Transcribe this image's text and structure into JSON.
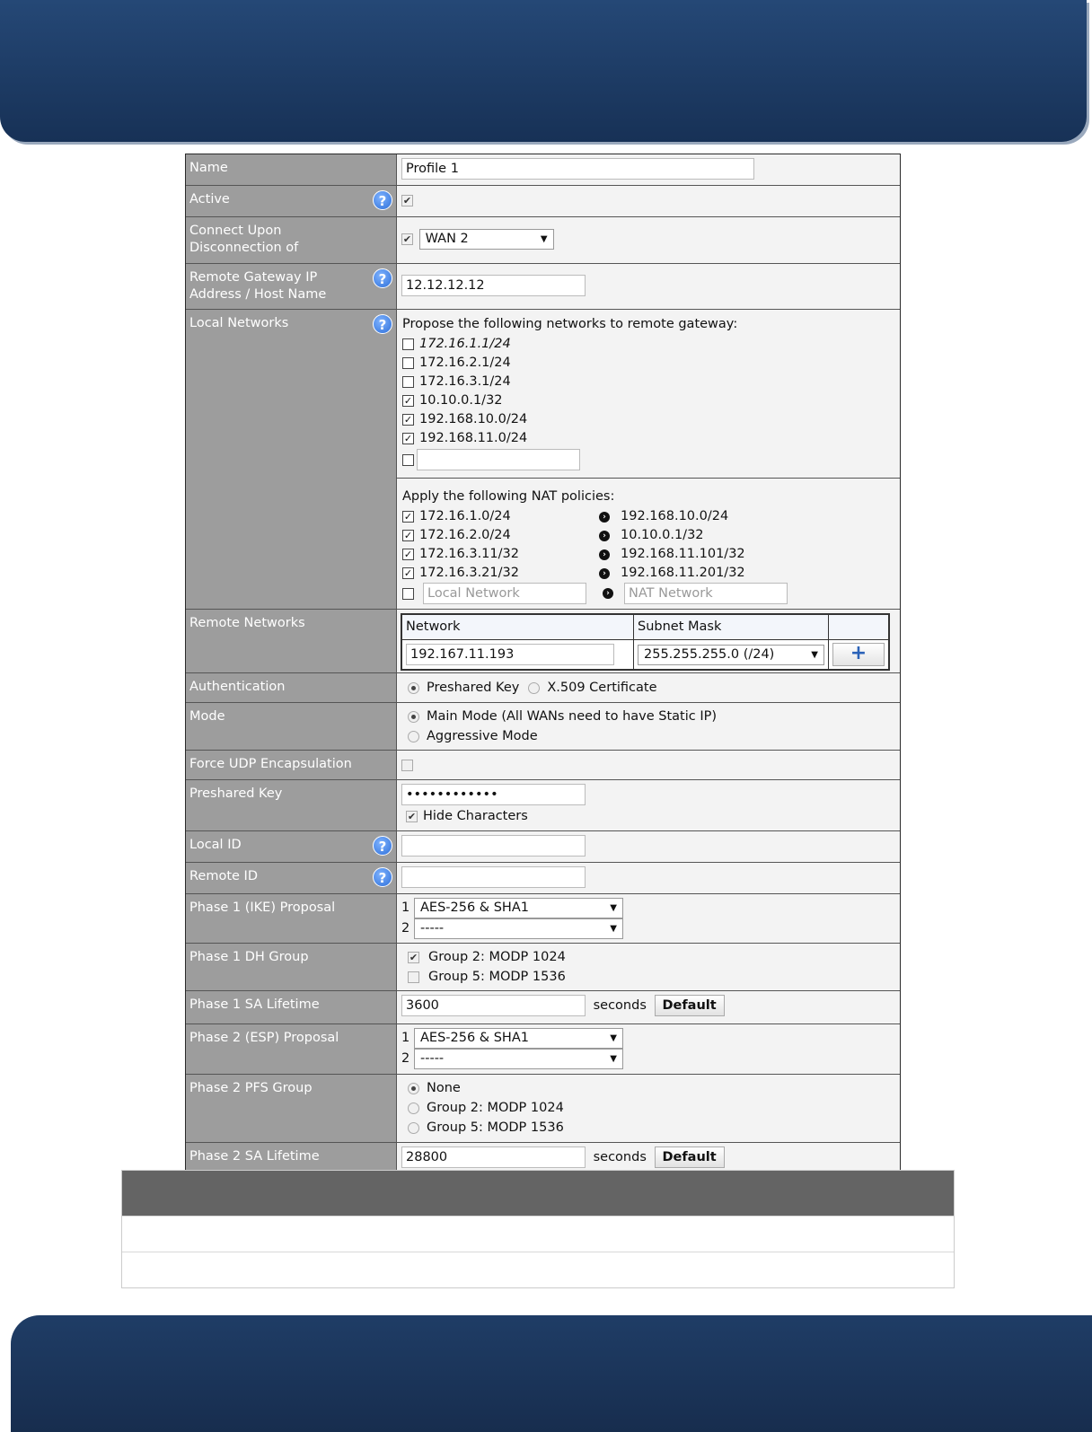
{
  "form": {
    "name": {
      "label": "Name",
      "value": "Profile 1"
    },
    "active": {
      "label": "Active",
      "checked": true
    },
    "connect_upon": {
      "label": "Connect Upon Disconnection of",
      "checked": true,
      "select": "WAN 2"
    },
    "remote_gateway": {
      "label": "Remote Gateway IP Address / Host Name",
      "value": "12.12.12.12"
    },
    "local_networks": {
      "label": "Local Networks",
      "propose_text": "Propose the following networks to remote gateway:",
      "networks": [
        {
          "label": "172.16.1.1/24",
          "checked": false
        },
        {
          "label": "172.16.2.1/24",
          "checked": false
        },
        {
          "label": "172.16.3.1/24",
          "checked": false
        },
        {
          "label": "10.10.0.1/32",
          "checked": true
        },
        {
          "label": "192.168.10.0/24",
          "checked": true
        },
        {
          "label": "192.168.11.0/24",
          "checked": true
        }
      ],
      "nat_text": "Apply the following NAT policies:",
      "nat": [
        {
          "from": "172.16.1.0/24",
          "to": "192.168.10.0/24",
          "checked": true
        },
        {
          "from": "172.16.2.0/24",
          "to": "10.10.0.1/32",
          "checked": true
        },
        {
          "from": "172.16.3.11/32",
          "to": "192.168.11.101/32",
          "checked": true
        },
        {
          "from": "172.16.3.21/32",
          "to": "192.168.11.201/32",
          "checked": true
        }
      ],
      "nat_local_placeholder": "Local Network",
      "nat_network_placeholder": "NAT Network"
    },
    "remote_networks": {
      "label": "Remote Networks",
      "col_network": "Network",
      "col_subnet": "Subnet Mask",
      "network_value": "192.167.11.193",
      "subnet_value": "255.255.255.0 (/24)",
      "add_icon": "plus-icon"
    },
    "authentication": {
      "label": "Authentication",
      "opt1": "Preshared Key",
      "opt2": "X.509 Certificate",
      "selected": "Preshared Key"
    },
    "mode": {
      "label": "Mode",
      "opt1": "Main Mode (All WANs need to have Static IP)",
      "opt2": "Aggressive Mode",
      "selected": "Main Mode"
    },
    "force_udp": {
      "label": "Force UDP Encapsulation",
      "checked": false
    },
    "preshared_key": {
      "label": "Preshared Key",
      "value": "••••••••••••",
      "hide_label": "Hide Characters",
      "hide_checked": true
    },
    "local_id": {
      "label": "Local ID",
      "value": ""
    },
    "remote_id": {
      "label": "Remote ID",
      "value": ""
    },
    "phase1_proposal": {
      "label": "Phase 1 (IKE) Proposal",
      "n1": "1",
      "v1": "AES-256 & SHA1",
      "n2": "2",
      "v2": "-----"
    },
    "phase1_dh": {
      "label": "Phase 1 DH Group",
      "opt1": "Group 2: MODP 1024",
      "opt2": "Group 5: MODP 1536"
    },
    "phase1_sa": {
      "label": "Phase 1 SA Lifetime",
      "value": "3600",
      "unit": "seconds",
      "button": "Default"
    },
    "phase2_proposal": {
      "label": "Phase 2 (ESP) Proposal",
      "n1": "1",
      "v1": "AES-256 & SHA1",
      "n2": "2",
      "v2": "-----"
    },
    "phase2_pfs": {
      "label": "Phase 2 PFS Group",
      "opt1": "None",
      "opt2": "Group 2: MODP 1024",
      "opt3": "Group 5: MODP 1536",
      "selected": "None"
    },
    "phase2_sa": {
      "label": "Phase 2 SA Lifetime",
      "value": "28800",
      "unit": "seconds",
      "button": "Default"
    }
  },
  "colors": {
    "header": "#1f3d66",
    "label_bg": "#9d9d9d",
    "help": "#2e6fd8"
  }
}
